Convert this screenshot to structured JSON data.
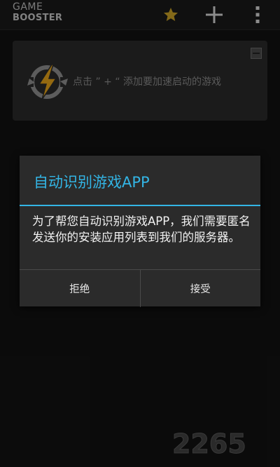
{
  "app": {
    "logo_line1": "GAME",
    "logo_line2": "BOOSTER"
  },
  "action_bar": {
    "icons": [
      "star-icon",
      "add-icon",
      "overflow-menu-icon"
    ],
    "accent_star": "#c9a227"
  },
  "card": {
    "hint_text": "点击 ” + “ 添加要加速启动的游戏",
    "icon": "lightning-refresh-icon"
  },
  "dialog": {
    "title": "自动识别游戏APP",
    "message": "为了帮您自动识别游戏APP，我们需要匿名发送你的安装应用列表到我们的服务器。",
    "buttons": {
      "reject_label": "拒绝",
      "accept_label": "接受"
    },
    "accent_color": "#33b5e5"
  },
  "watermark": {
    "text": "2265"
  }
}
